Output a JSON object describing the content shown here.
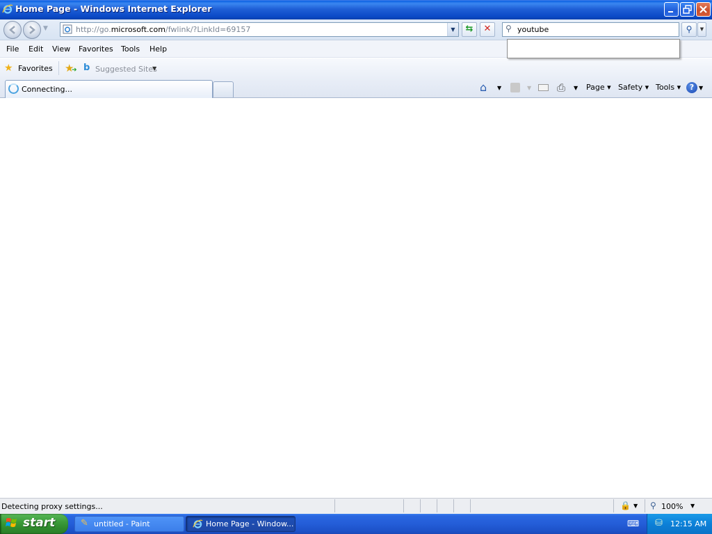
{
  "window": {
    "title": "Home Page - Windows Internet Explorer"
  },
  "address": {
    "url_prefix": "http://go.",
    "url_domain": "microsoft.com",
    "url_path": "/fwlink/?LinkId=69157"
  },
  "search": {
    "value": "youtube"
  },
  "menu": {
    "file": "File",
    "edit": "Edit",
    "view": "View",
    "favorites": "Favorites",
    "tools": "Tools",
    "help": "Help"
  },
  "favorites_bar": {
    "favorites_label": "Favorites",
    "suggested_sites": "Suggested Sites"
  },
  "tab": {
    "label": "Connecting..."
  },
  "commands": {
    "page": "Page",
    "safety": "Safety",
    "tools": "Tools"
  },
  "status": {
    "text": "Detecting proxy settings...",
    "zoom": "100%"
  },
  "taskbar": {
    "start": "start",
    "tasks": [
      {
        "label": "untitled - Paint"
      },
      {
        "label": "Home Page - Window..."
      }
    ],
    "clock": "12:15 AM"
  },
  "colors": {
    "titlebar": "#0a49c6",
    "taskbar": "#245dd8",
    "start_button": "#3c9c3a"
  }
}
